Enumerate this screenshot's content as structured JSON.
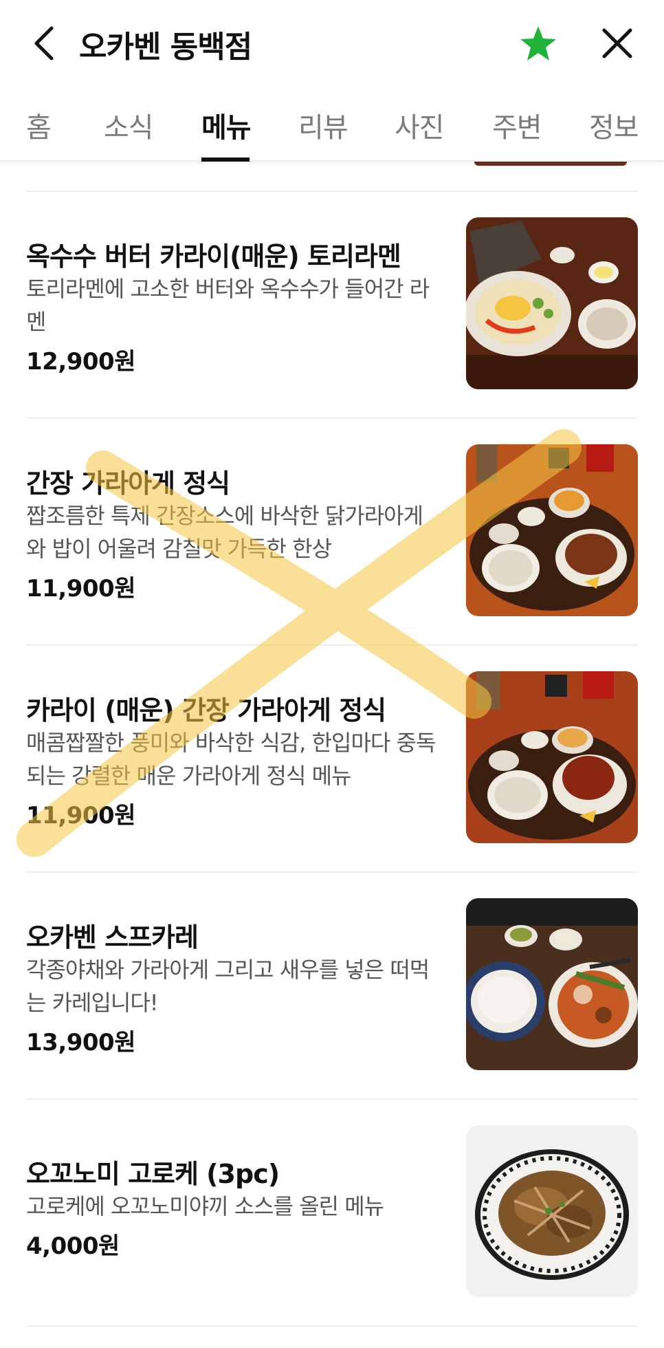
{
  "header": {
    "title": "오카벤 동백점",
    "star_color": "#1fb33a"
  },
  "tabs": [
    {
      "label": "홈"
    },
    {
      "label": "소식"
    },
    {
      "label": "메뉴"
    },
    {
      "label": "리뷰"
    },
    {
      "label": "사진"
    },
    {
      "label": "주변"
    },
    {
      "label": "정보"
    }
  ],
  "active_tab": "메뉴",
  "menu": [
    {
      "name": "옥수수 버터 카라이(매운) 토리라멘",
      "desc": "토리라멘에 고소한 버터와 옥수수가 들어간 라멘",
      "price": "12,900원"
    },
    {
      "name": "간장 가라아게 정식",
      "desc": "짭조름한 특제 간장소스에 바삭한 닭가라아게와 밥이 어울려 감칠맛 가득한 한상",
      "price": "11,900원"
    },
    {
      "name": "카라이 (매운) 간장 가라아게 정식",
      "desc": "매콤짭짤한 풍미와 바삭한 식감, 한입마다 중독되는 강렬한 매운 가라아게 정식 메뉴",
      "price": "11,900원"
    },
    {
      "name": "오카벤 스프카레",
      "desc": "각종야채와 가라아게 그리고 새우를 넣은 떠먹는 카레입니다!",
      "price": "13,900원"
    },
    {
      "name": "오꼬노미 고로케 (3pc)",
      "desc": "고로케에 오꼬노미야끼 소스를 올린 메뉴",
      "price": "4,000원"
    }
  ]
}
